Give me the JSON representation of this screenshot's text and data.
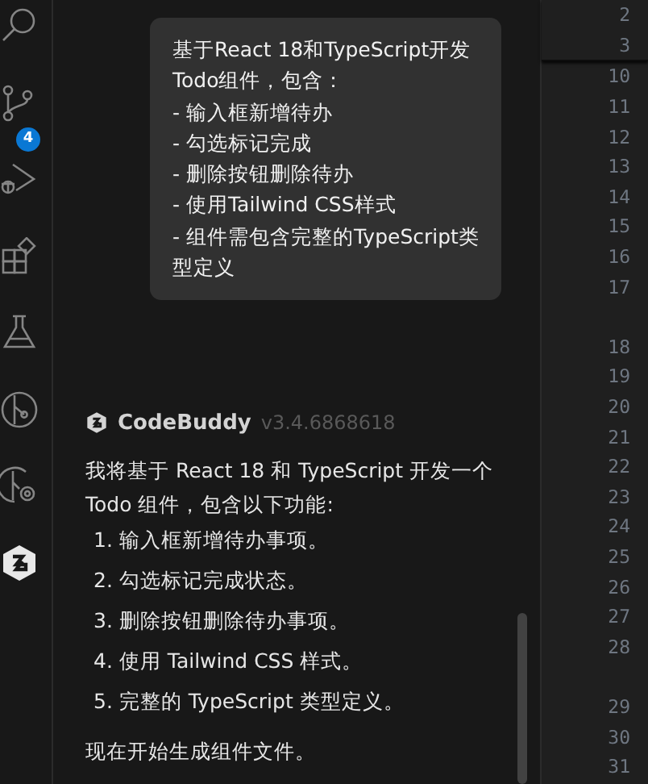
{
  "activity_bar": {
    "items": [
      {
        "selected": false
      },
      {
        "selected": false,
        "badge": "4"
      },
      {
        "selected": false
      },
      {
        "selected": false
      },
      {
        "selected": false
      },
      {
        "selected": false
      },
      {
        "selected": false
      },
      {
        "selected": true
      }
    ]
  },
  "chat": {
    "user_message": [
      "基于React 18和TypeScript开发Todo组件，包含：",
      "- 输入框新增待办",
      "- 勾选标记完成",
      "- 删除按钮删除待办",
      "- 使用Tailwind CSS样式",
      "- 组件需包含完整的TypeScript类型定义"
    ],
    "assistant": {
      "name": "CodeBuddy",
      "version": "v3.4.6868618",
      "intro": "我将基于 React 18 和 TypeScript 开发一个 Todo 组件，包含以下功能:",
      "items": [
        "1. 输入框新增待办事项。",
        "2. 勾选标记完成状态。",
        "3. 删除按钮删除待办事项。",
        "4. 使用 Tailwind CSS 样式。",
        "5. 完整的 TypeScript 类型定义。"
      ],
      "outro": "现在开始生成组件文件。"
    }
  },
  "editor": {
    "sticky_lines": [
      "2",
      "3"
    ],
    "lines": [
      {
        "n": "10",
        "wrapped": false
      },
      {
        "n": "11",
        "wrapped": false
      },
      {
        "n": "12",
        "wrapped": false
      },
      {
        "n": "13",
        "wrapped": false
      },
      {
        "n": "14",
        "wrapped": false
      },
      {
        "n": "15",
        "wrapped": false
      },
      {
        "n": "16",
        "wrapped": false
      },
      {
        "n": "17",
        "wrapped": true
      },
      {
        "n": "18",
        "wrapped": false
      },
      {
        "n": "19",
        "wrapped": false
      },
      {
        "n": "20",
        "wrapped": false
      },
      {
        "n": "21",
        "wrapped": false
      },
      {
        "n": "22",
        "wrapped": false
      },
      {
        "n": "23",
        "wrapped": false
      },
      {
        "n": "24",
        "wrapped": false
      },
      {
        "n": "25",
        "wrapped": false
      },
      {
        "n": "26",
        "wrapped": false
      },
      {
        "n": "27",
        "wrapped": false
      },
      {
        "n": "28",
        "wrapped": true
      },
      {
        "n": "29",
        "wrapped": false
      },
      {
        "n": "30",
        "wrapped": false
      },
      {
        "n": "31",
        "wrapped": false
      }
    ]
  }
}
